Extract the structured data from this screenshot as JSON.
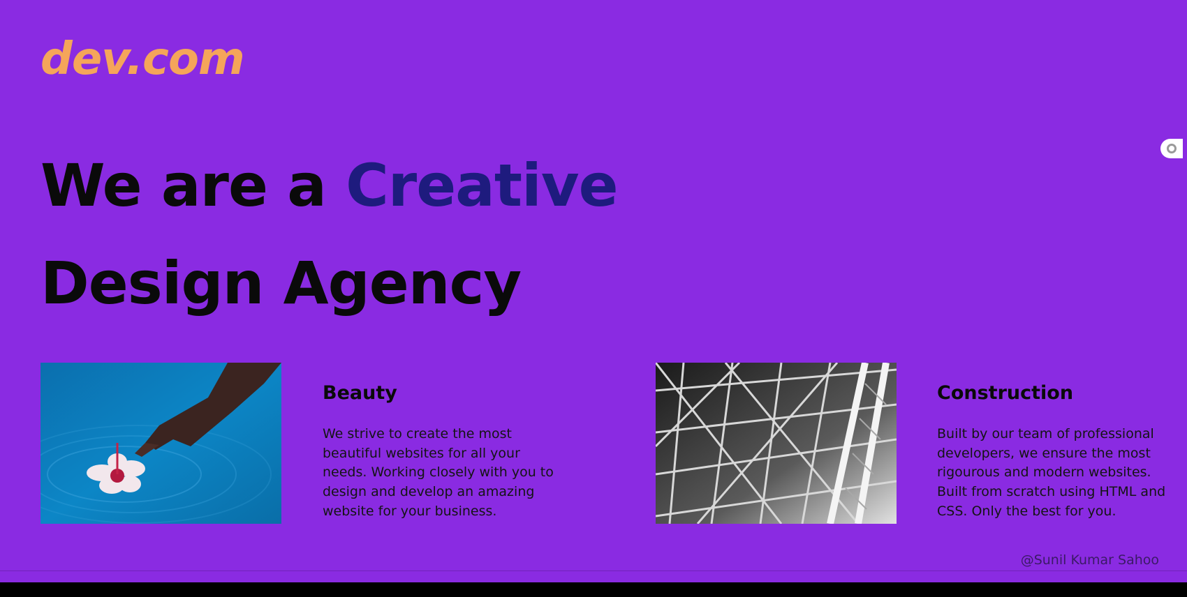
{
  "brand": {
    "logo": "dev.com",
    "logo_color": "#f5a55a"
  },
  "hero": {
    "line1_prefix": "We are a ",
    "line1_accent": "Creative",
    "line2": "Design Agency",
    "accent_color": "#1e1b7e"
  },
  "cards": [
    {
      "title": "Beauty",
      "text": "We strive to create the most beautiful websites for all your needs. Working closely with you to design and develop an amazing website for your business.",
      "image": "hand-and-flower-in-water"
    },
    {
      "title": "Construction",
      "text": "Built by our team of professional developers, we ensure the most rigourous and modern websites. Built from scratch using HTML and CSS. Only the best for you.",
      "image": "steel-structure-black-and-white"
    }
  ],
  "footer": {
    "credit": "@Sunil Kumar Sahoo"
  },
  "colors": {
    "background": "#8a2be2",
    "text": "#0a0a0a"
  }
}
